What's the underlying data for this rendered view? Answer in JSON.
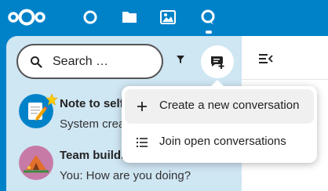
{
  "header": {
    "logo_icon": "nextcloud-logo",
    "apps": [
      {
        "name": "dashboard",
        "icon": "circle-icon"
      },
      {
        "name": "files",
        "icon": "folder-icon"
      },
      {
        "name": "photos",
        "icon": "image-icon"
      },
      {
        "name": "talk",
        "icon": "talk-icon",
        "active": true
      }
    ]
  },
  "sidebar": {
    "search_placeholder": "Search …",
    "conversations": [
      {
        "title": "Note to self",
        "subtitle": "System created",
        "favorite": true
      },
      {
        "title": "Team building",
        "subtitle": "You: How are you doing?"
      }
    ]
  },
  "menu": {
    "items": [
      {
        "label": "Create a new conversation",
        "icon": "plus-icon"
      },
      {
        "label": "Join open conversations",
        "icon": "list-icon"
      }
    ]
  },
  "colors": {
    "brand": "#0082c9",
    "sidebar_bg": "#cfe6f3",
    "hover_bg": "#f0f0f0"
  }
}
